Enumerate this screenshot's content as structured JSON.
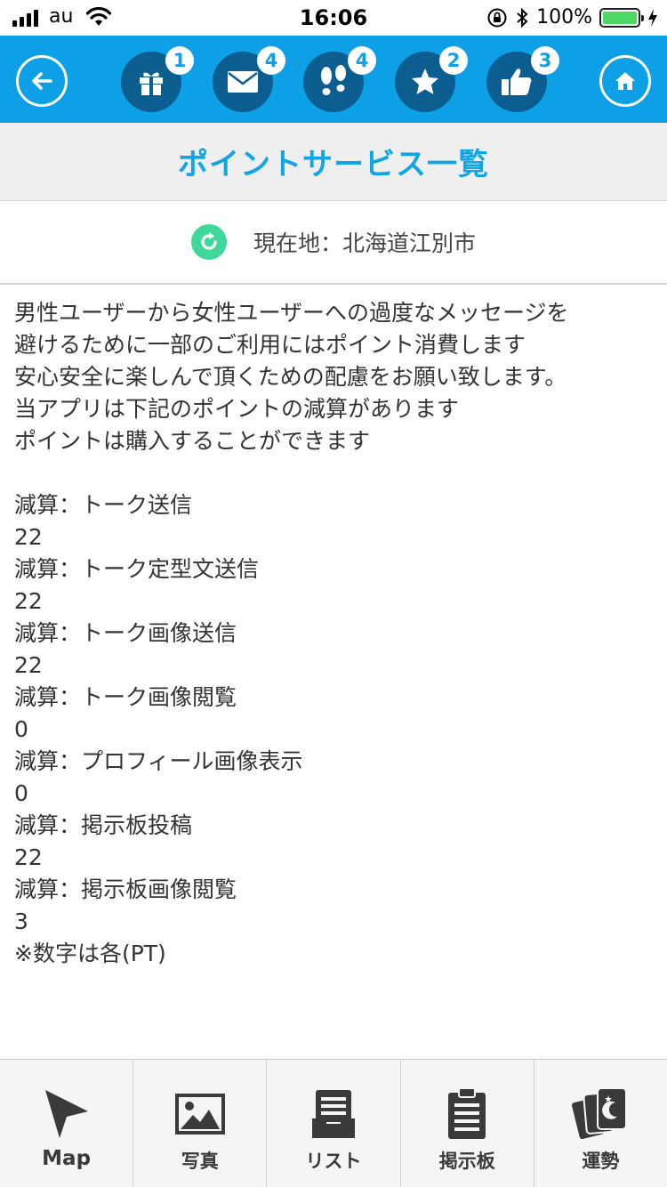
{
  "status_bar": {
    "carrier": "au",
    "time": "16:06",
    "battery": "100%"
  },
  "nav": {
    "badges": {
      "gift": "1",
      "mail": "4",
      "footprints": "4",
      "star": "2",
      "like": "3"
    }
  },
  "title": "ポイントサービス一覧",
  "location": "現在地：北海道江別市",
  "intro": [
    "男性ユーザーから女性ユーザーへの過度なメッセージを",
    "避けるために一部のご利用にはポイント消費します",
    "安心安全に楽しんで頂くための配慮をお願い致します。",
    "当アプリは下記のポイントの減算があります",
    "ポイントは購入することができます"
  ],
  "deductions": [
    {
      "label": "減算：トーク送信",
      "value": "22"
    },
    {
      "label": "減算：トーク定型文送信",
      "value": "22"
    },
    {
      "label": "減算：トーク画像送信",
      "value": "22"
    },
    {
      "label": "減算：トーク画像閲覧",
      "value": "0"
    },
    {
      "label": "減算：プロフィール画像表示",
      "value": "0"
    },
    {
      "label": "減算：掲示板投稿",
      "value": "22"
    },
    {
      "label": "減算：掲示板画像閲覧",
      "value": "3"
    }
  ],
  "note": "※数字は各(PT)",
  "tabs": {
    "map": "Map",
    "photo": "写真",
    "list": "リスト",
    "board": "掲示板",
    "fortune": "運勢"
  }
}
